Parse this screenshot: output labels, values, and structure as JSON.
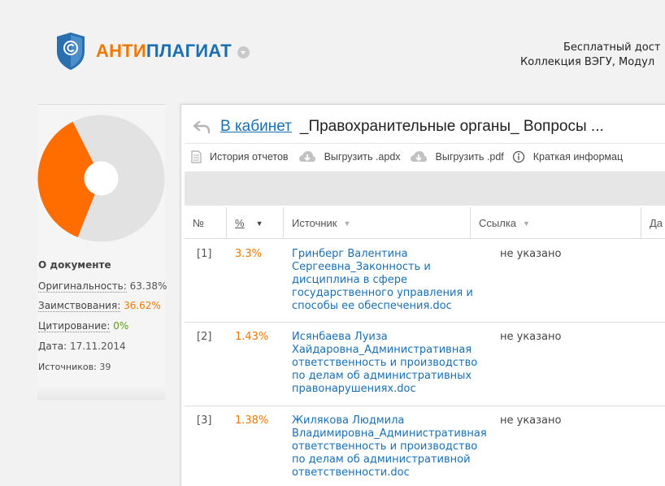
{
  "header": {
    "logo_part1": "АНТИ",
    "logo_part2": "ПЛАГИАТ",
    "right_line1": "Бесплатный дост",
    "right_line2": "Коллекция ВЭГУ, Модул"
  },
  "sidebar": {
    "about_title": "О документе",
    "stats": [
      {
        "label": "Оригинальность:",
        "value": "63.38%"
      },
      {
        "label": "Заимствования:",
        "value": "36.62%"
      },
      {
        "label": "Цитирование:",
        "value": "0%"
      },
      {
        "label": "Дата:",
        "value": "17.11.2014"
      },
      {
        "label": "Источников:",
        "value": "39"
      }
    ],
    "pie": {
      "originality": 63.38,
      "borrowing": 36.62,
      "colors": {
        "originality": "#e2e2e2",
        "borrowing": "#ff6d00"
      }
    }
  },
  "panel": {
    "cabinet_link": "В кабинет",
    "doc_title": "_Правохранительные органы_ Вопросы ...",
    "toolbar": {
      "history": "История отчетов",
      "export_apdx": "Выгрузить .apdx",
      "export_pdf": "Выгрузить .pdf",
      "brief": "Краткая информац"
    },
    "columns": {
      "num": "№",
      "percent": "%",
      "source": "Источник",
      "link": "Ссылка",
      "date": "Да"
    },
    "rows": [
      {
        "num": "[1]",
        "percent": "3.3%",
        "source_lines": [
          "Гринберг Валентина",
          "Сергеевна_Законность и",
          "дисциплина в сфере",
          "государственного управления и",
          "способы ее обеспечения.doc"
        ],
        "link": "не указано"
      },
      {
        "num": "[2]",
        "percent": "1.43%",
        "source_lines": [
          "Исянбаева Луиза",
          "Хайдаровна_Административная",
          "ответственность и производство",
          "по делам об административных",
          "правонарушениях.doc"
        ],
        "link": "не указано"
      },
      {
        "num": "[3]",
        "percent": "1.38%",
        "source_lines": [
          "Жилякова Людмила",
          "Владимировна_Административная",
          "ответственность и производство",
          "по делам об административной",
          "ответственности.doc"
        ],
        "link": "не указано"
      }
    ]
  },
  "colors": {
    "accent_orange": "#f07800",
    "link_blue": "#1a6fb0",
    "citation_green": "#5a9a1c"
  }
}
